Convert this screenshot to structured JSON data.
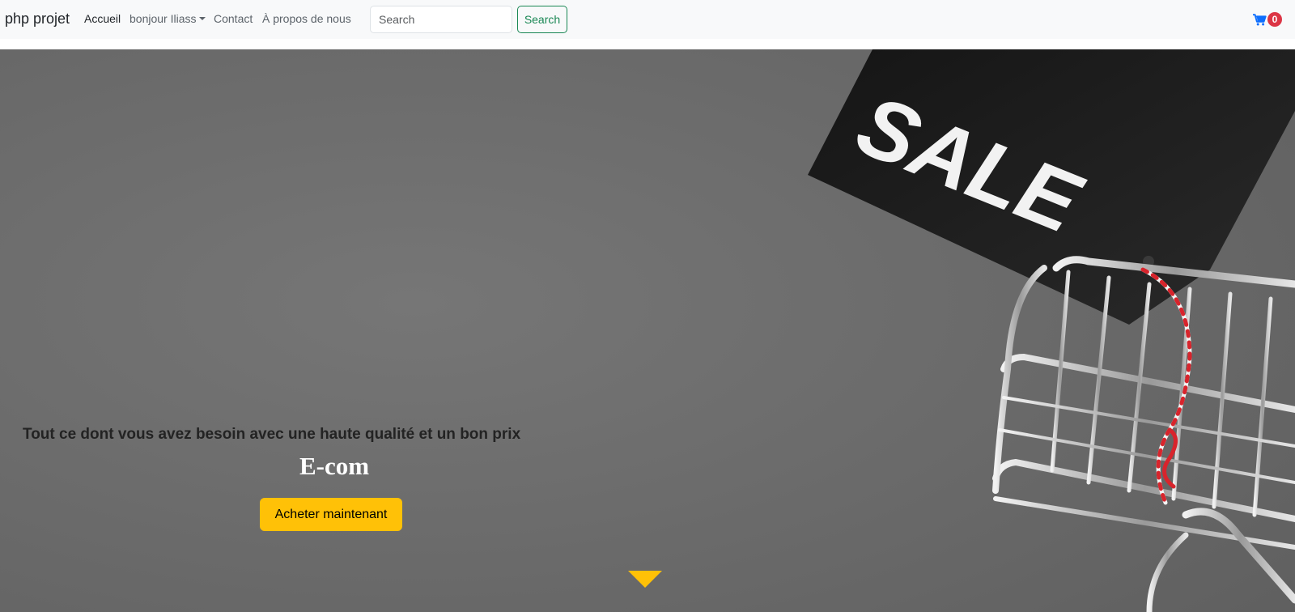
{
  "navbar": {
    "brand": "php projet",
    "links": [
      {
        "label": "Accueil",
        "active": true
      },
      {
        "label": "bonjour Iliass",
        "dropdown": true
      },
      {
        "label": "Contact"
      },
      {
        "label": "À propos de nous"
      }
    ],
    "search": {
      "placeholder": "Search",
      "value": "",
      "button_label": "Search"
    },
    "cart": {
      "icon": "shopping-cart-icon",
      "count": "0"
    }
  },
  "hero": {
    "image_tag_text": "SALE",
    "tagline": "Tout ce dont vous avez besoin avec une haute qualité et un bon prix",
    "title": "E-com",
    "cta_label": "Acheter maintenant",
    "scroll_icon": "scroll-down-icon"
  },
  "colors": {
    "navbar_bg": "#f8f9fa",
    "search_button": "#198754",
    "cart_icon": "#0d6efd",
    "badge": "#dc3545",
    "cta": "#ffc107",
    "hero_bg": "#6e6e6e"
  }
}
